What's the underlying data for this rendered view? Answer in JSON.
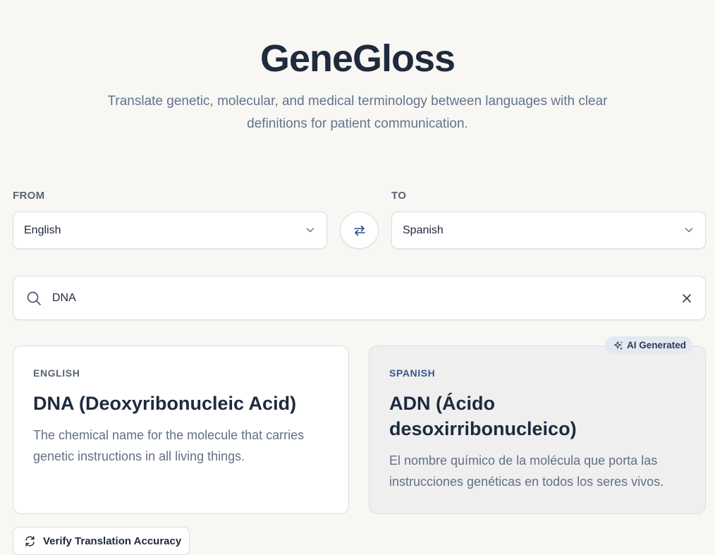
{
  "header": {
    "title": "GeneGloss",
    "subtitle": "Translate genetic, molecular, and medical terminology between languages with clear definitions for patient communication."
  },
  "language_selector": {
    "from_label": "FROM",
    "from_value": "English",
    "to_label": "TO",
    "to_value": "Spanish"
  },
  "search": {
    "value": "DNA",
    "icons": {
      "search": "search-icon",
      "clear": "close-icon"
    }
  },
  "source_card": {
    "language": "ENGLISH",
    "term": "DNA (Deoxyribonucleic Acid)",
    "definition": "The chemical name for the molecule that carries genetic instructions in all living things."
  },
  "target_card": {
    "badge": "AI Generated",
    "language": "SPANISH",
    "term": "ADN (Ácido desoxirribonucleico)",
    "definition": "El nombre químico de la molécula que porta las instrucciones genéticas en todos los seres vivos."
  },
  "actions": {
    "verify_label": "Verify Translation Accuracy"
  },
  "colors": {
    "background": "#f8f7f4",
    "accent": "#3b5688",
    "badge_bg": "#e3e8f1",
    "border": "#d8dde6"
  }
}
